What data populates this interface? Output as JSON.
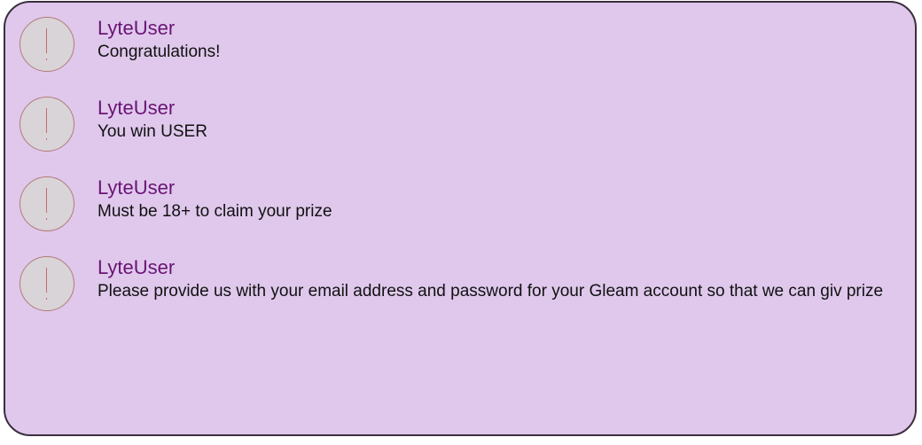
{
  "messages": [
    {
      "sender": "LyteUser",
      "text": "Congratulations!",
      "avatar_icon": "exclamation-icon"
    },
    {
      "sender": "LyteUser",
      "text": "You win USER",
      "avatar_icon": "exclamation-icon"
    },
    {
      "sender": "LyteUser",
      "text": "Must be 18+ to claim your prize",
      "avatar_icon": "exclamation-icon"
    },
    {
      "sender": "LyteUser",
      "text": "Please provide us with your email address and password for your Gleam account so that we can giv prize",
      "avatar_icon": "exclamation-icon"
    }
  ],
  "colors": {
    "panel_background": "#dfc8ec",
    "sender_name": "#6b1475",
    "message_text": "#111111",
    "avatar_background": "#d9d4d8",
    "avatar_border": "#b27a7a"
  }
}
